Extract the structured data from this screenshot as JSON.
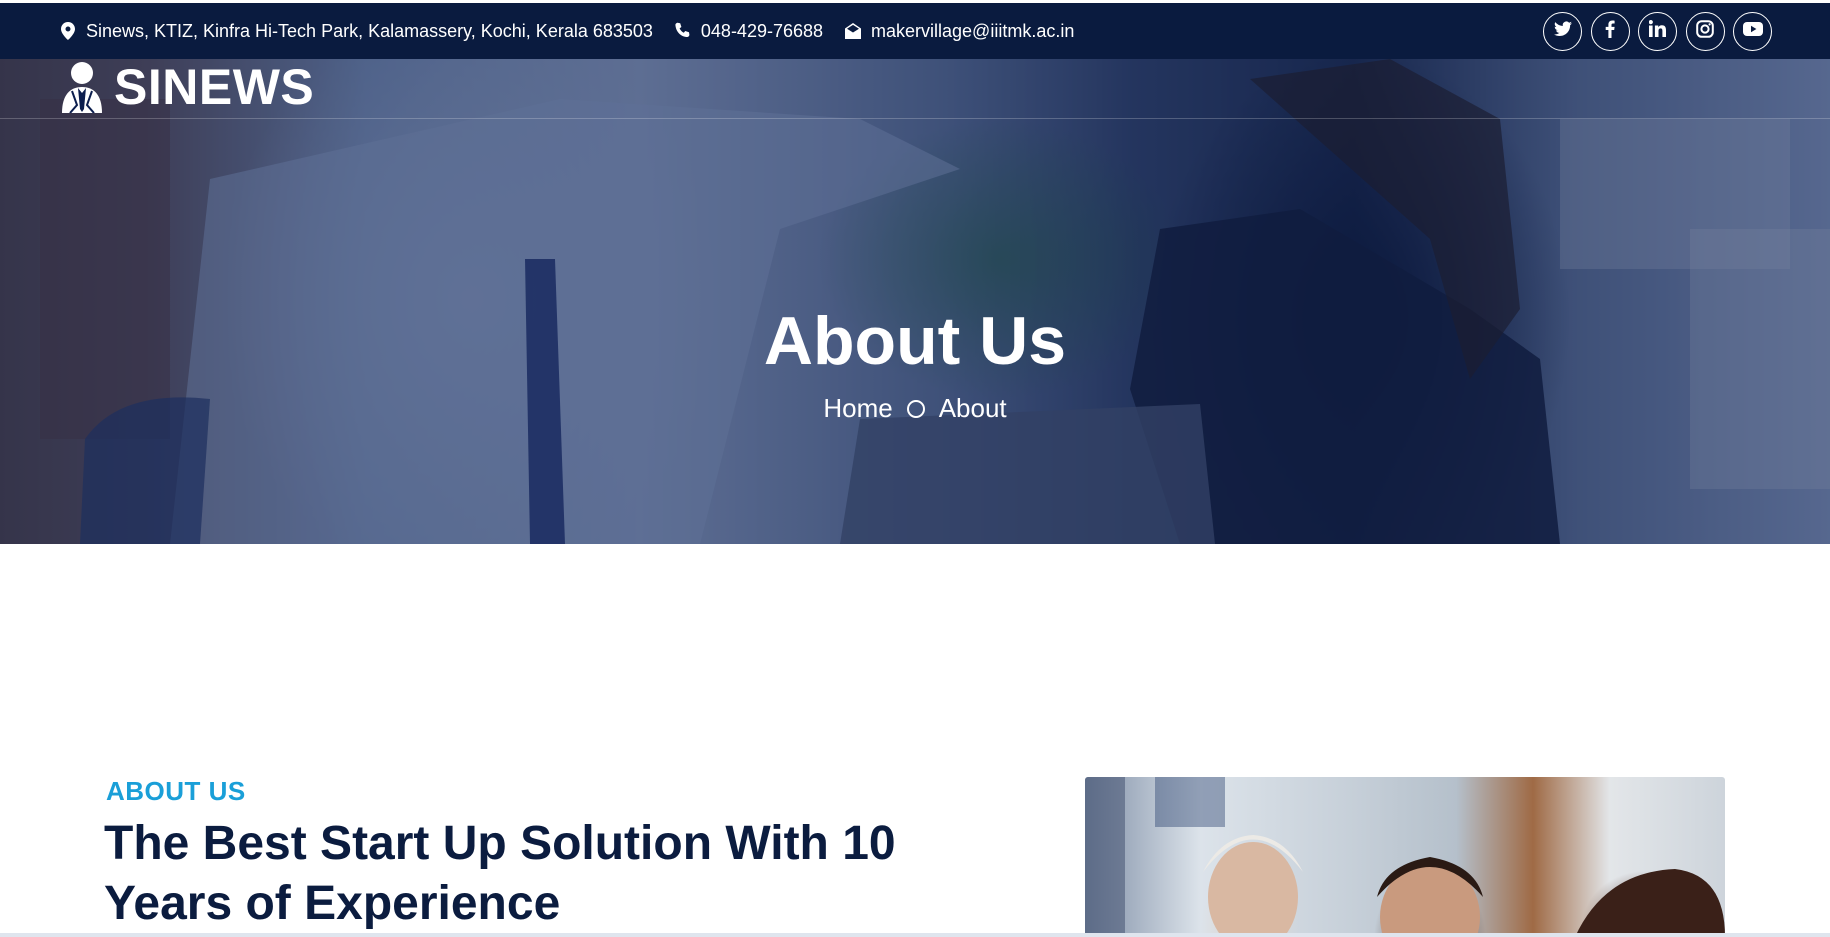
{
  "topbar": {
    "address": "Sinews, KTIZ, Kinfra Hi-Tech Park, Kalamassery, Kochi, Kerala 683503",
    "phone": "048-429-76688",
    "email": "makervillage@iiitmk.ac.in",
    "socials": [
      "twitter-icon",
      "facebook-icon",
      "linkedin-icon",
      "instagram-icon",
      "youtube-icon"
    ],
    "background_color": "#0a1b3f"
  },
  "logo": {
    "text": "SINEWS"
  },
  "hero": {
    "title": "About Us",
    "breadcrumb": {
      "home": "Home",
      "current": "About"
    }
  },
  "about": {
    "tag": "ABOUT US",
    "heading": "The Best Start Up Solution With 10 Years of Experience",
    "tag_color": "#1a9fd8",
    "heading_color": "#0b1c3f"
  }
}
